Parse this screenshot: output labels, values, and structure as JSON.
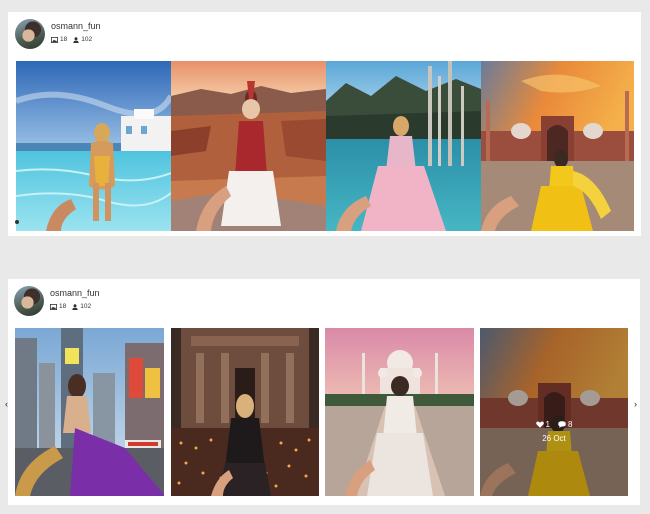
{
  "feeds": [
    {
      "profile": {
        "username": "osmann_fun",
        "posts_count": "18",
        "followers_count": "102"
      },
      "photos": [
        {
          "alt": "Woman in yellow swimsuit leading by the hand into an infinity pool in Santorini"
        },
        {
          "alt": "Woman in red and white dress on a canyon cliff edge"
        },
        {
          "alt": "Woman in pink dress at a turquoise lake with sunken trees"
        },
        {
          "alt": "Woman in yellow dress in front of a mosque at sunset"
        }
      ]
    },
    {
      "profile": {
        "username": "osmann_fun",
        "posts_count": "18",
        "followers_count": "102"
      },
      "photos": [
        {
          "alt": "Woman in purple skirt on a busy city street with billboards"
        },
        {
          "alt": "Woman among candles in front of the Petra treasury"
        },
        {
          "alt": "Woman in white dress walking towards the Taj Mahal"
        },
        {
          "alt": "Woman in yellow dress in front of a mosque",
          "likes": "1",
          "comments": "8",
          "date": "26 Oct"
        }
      ],
      "nav": {
        "prev": "‹",
        "next": "›"
      }
    }
  ],
  "colors": {
    "card_bg": "#ffffff",
    "page_bg": "#e9e9e9",
    "text": "#333333"
  }
}
